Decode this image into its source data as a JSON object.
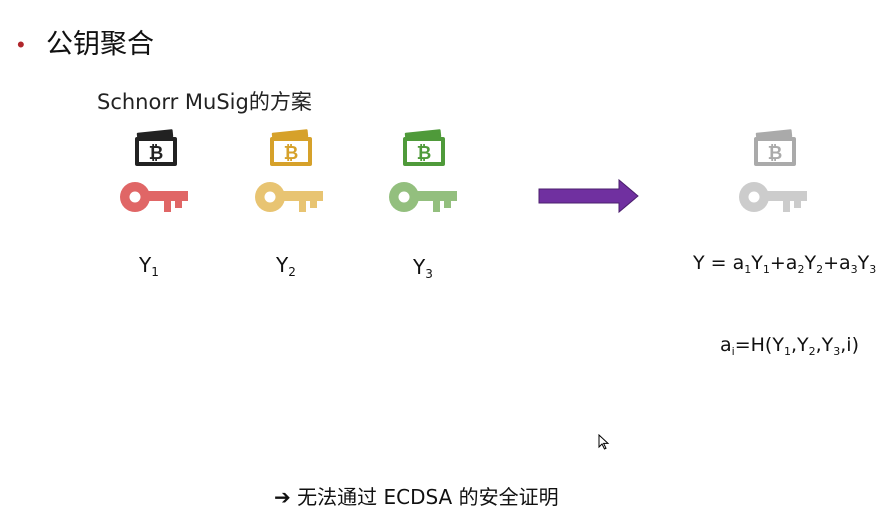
{
  "slide": {
    "bullet": "•",
    "title": "公钥聚合",
    "subtitle": "Schnorr MuSig的方案"
  },
  "keys": [
    {
      "name": "Y",
      "sub": "1",
      "color": "#e06666",
      "wallet_color": "#222222"
    },
    {
      "name": "Y",
      "sub": "2",
      "color": "#e8c472",
      "wallet_color": "#d6a12a"
    },
    {
      "name": "Y",
      "sub": "3",
      "color": "#93bf7e",
      "wallet_color": "#4f9a3a"
    }
  ],
  "aggregate": {
    "key_color": "#cccccc",
    "wallet_color": "#aaaaaa",
    "arrow_color": "#7030a0",
    "formula1": {
      "lhs": "Y = ",
      "terms": [
        {
          "a": "a",
          "asub": "1",
          "y": "Y",
          "ysub": "1",
          "plus": "+"
        },
        {
          "a": "a",
          "asub": "2",
          "y": "Y",
          "ysub": "2",
          "plus": "+"
        },
        {
          "a": "a",
          "asub": "3",
          "y": "Y",
          "ysub": "3",
          "plus": ""
        }
      ]
    },
    "formula2": {
      "a": "a",
      "asub": "i",
      "mid": "=H(",
      "y1": "Y",
      "y1sub": "1",
      "comma1": ",",
      "y2": "Y",
      "y2sub": "2",
      "comma2": ",",
      "y3": "Y",
      "y3sub": "3",
      "end": ",i)"
    }
  },
  "footer": {
    "arrow": "➔",
    "text": "无法通过 ECDSA 的安全证明"
  }
}
